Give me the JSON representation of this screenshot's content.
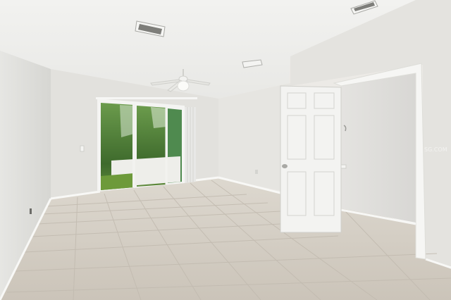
{
  "scene": {
    "colors": {
      "ceiling": "#eeeeec",
      "left_wall": "#dfdfdc",
      "back_wall": "#e3e2de",
      "right_wall": "#e6e5e2",
      "floor": "#d3cdc4",
      "grout": "#bdb6ac",
      "door": "#f4f4f2",
      "foliage": "#4f7f3a",
      "sky": "#dfe9dc",
      "baseboard": "#f7f7f5"
    },
    "fixtures": [
      "ceiling-fan",
      "air-vent",
      "sliding-glass-door",
      "open-six-panel-door",
      "bathroom-doorway"
    ],
    "watermark": "SG.COM"
  }
}
